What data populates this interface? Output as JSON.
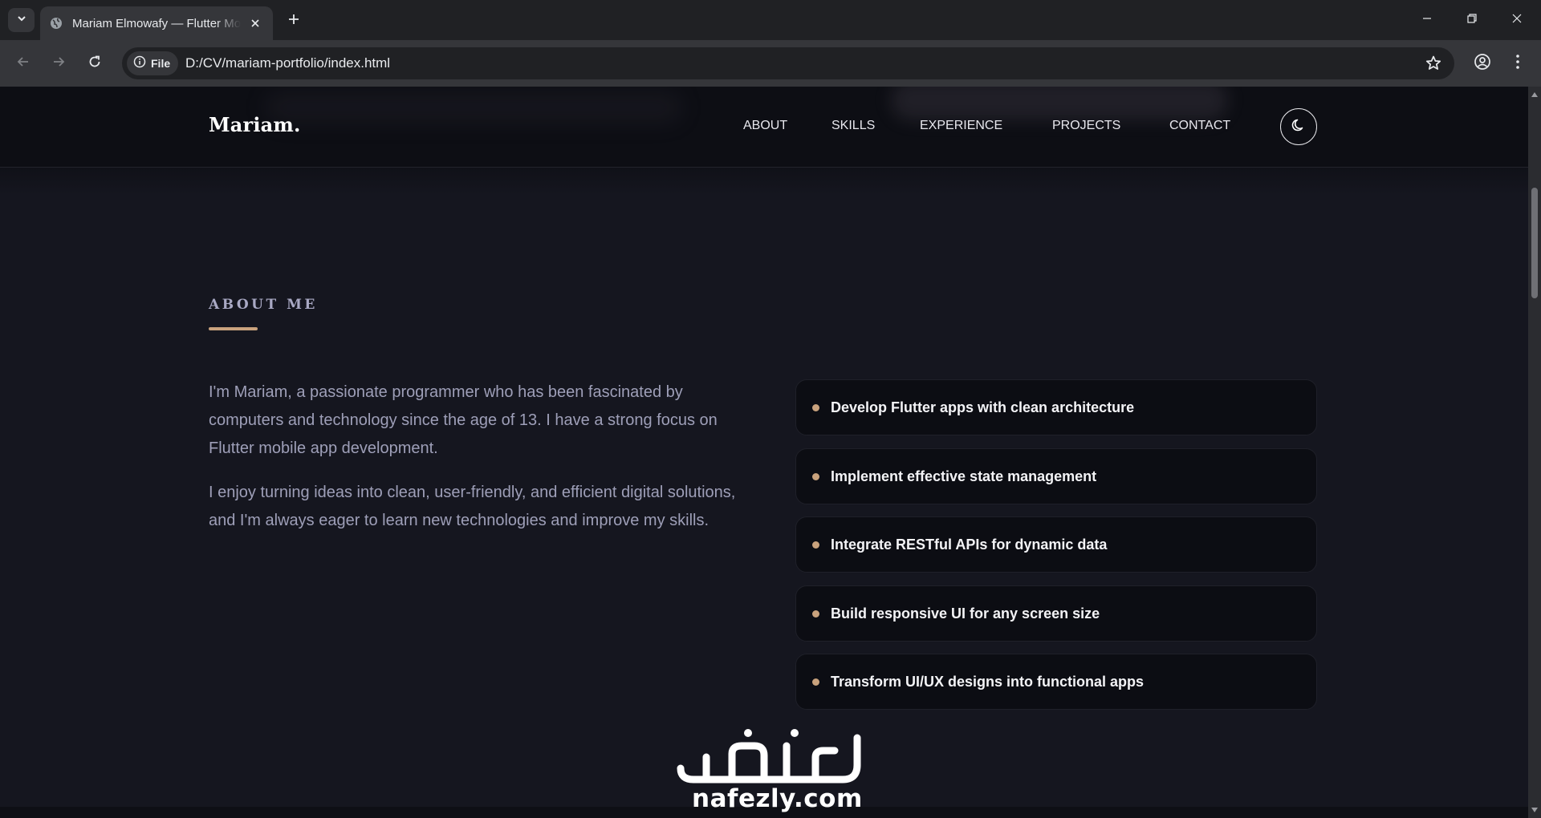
{
  "browser": {
    "tab_title": "Mariam Elmowafy — Flutter Mobile Developer",
    "site_chip_label": "File",
    "url": "D:/CV/mariam-portfolio/index.html"
  },
  "site": {
    "logo": "Mariam.",
    "nav": [
      "ABOUT",
      "SKILLS",
      "EXPERIENCE",
      "PROJECTS",
      "CONTACT"
    ]
  },
  "about": {
    "section_label": "ABOUT ME",
    "paragraphs": [
      "I'm Mariam, a passionate programmer who has been fascinated by computers and technology since the age of 13. I have a strong focus on Flutter mobile app development.",
      "I enjoy turning ideas into clean, user-friendly, and efficient digital solutions, and I'm always eager to learn new technologies and improve my skills."
    ],
    "highlights": [
      "Develop Flutter apps with clean architecture",
      "Implement effective state management",
      "Integrate RESTful APIs for dynamic data",
      "Build responsive UI for any screen size",
      "Transform UI/UX designs into functional apps"
    ]
  },
  "watermark": {
    "arabic": "نفذلي",
    "latin": "nafezly.com"
  },
  "colors": {
    "accent": "#c9a27d",
    "page_bg": "#15161f",
    "header_bg": "#0d0e14",
    "card_bg": "#0c0d13"
  }
}
